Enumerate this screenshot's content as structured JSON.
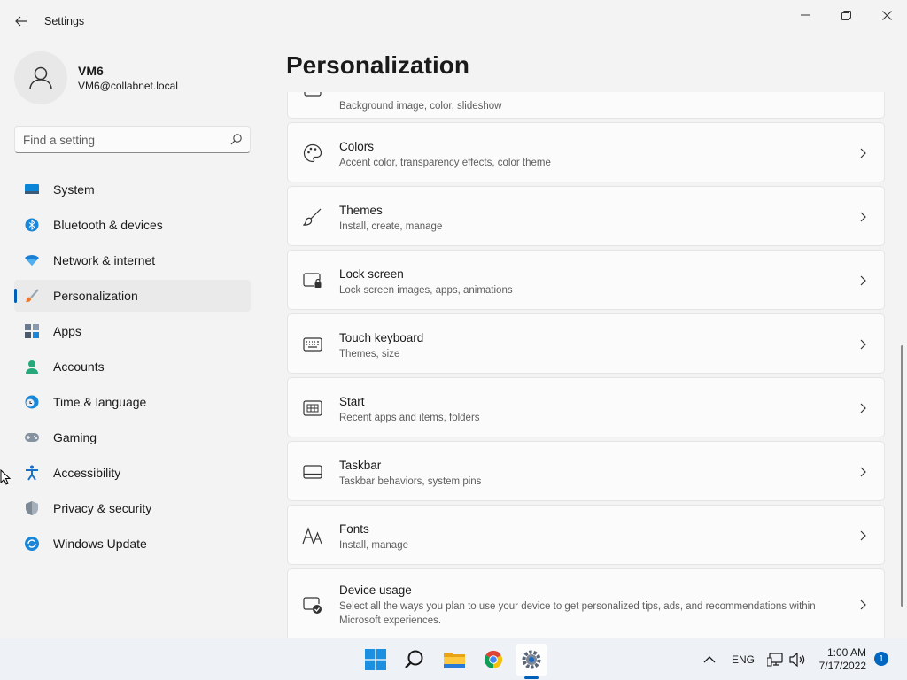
{
  "window": {
    "title": "Settings",
    "controls": [
      "minimize",
      "maximize",
      "close"
    ]
  },
  "profile": {
    "name": "VM6",
    "email": "VM6@collabnet.local"
  },
  "search": {
    "placeholder": "Find a setting"
  },
  "sidebar": {
    "items": [
      {
        "label": "System",
        "icon": "system-icon",
        "selected": false
      },
      {
        "label": "Bluetooth & devices",
        "icon": "bluetooth-icon",
        "selected": false
      },
      {
        "label": "Network & internet",
        "icon": "wifi-icon",
        "selected": false
      },
      {
        "label": "Personalization",
        "icon": "brush-icon",
        "selected": true
      },
      {
        "label": "Apps",
        "icon": "apps-icon",
        "selected": false
      },
      {
        "label": "Accounts",
        "icon": "accounts-icon",
        "selected": false
      },
      {
        "label": "Time & language",
        "icon": "time-language-icon",
        "selected": false
      },
      {
        "label": "Gaming",
        "icon": "gaming-icon",
        "selected": false
      },
      {
        "label": "Accessibility",
        "icon": "accessibility-icon",
        "selected": false
      },
      {
        "label": "Privacy & security",
        "icon": "shield-icon",
        "selected": false
      },
      {
        "label": "Windows Update",
        "icon": "update-icon",
        "selected": false
      }
    ]
  },
  "main": {
    "title": "Personalization",
    "cards": [
      {
        "title": "",
        "subtitle": "Background image, color, slideshow",
        "icon": "background-icon"
      },
      {
        "title": "Colors",
        "subtitle": "Accent color, transparency effects, color theme",
        "icon": "palette-icon"
      },
      {
        "title": "Themes",
        "subtitle": "Install, create, manage",
        "icon": "brush-icon"
      },
      {
        "title": "Lock screen",
        "subtitle": "Lock screen images, apps, animations",
        "icon": "lock-screen-icon"
      },
      {
        "title": "Touch keyboard",
        "subtitle": "Themes, size",
        "icon": "keyboard-icon"
      },
      {
        "title": "Start",
        "subtitle": "Recent apps and items, folders",
        "icon": "start-icon"
      },
      {
        "title": "Taskbar",
        "subtitle": "Taskbar behaviors, system pins",
        "icon": "taskbar-icon"
      },
      {
        "title": "Fonts",
        "subtitle": "Install, manage",
        "icon": "fonts-icon"
      },
      {
        "title": "Device usage",
        "subtitle": "Select all the ways you plan to use your device to get personalized tips, ads, and recommendations within Microsoft experiences.",
        "icon": "device-usage-icon"
      }
    ]
  },
  "taskbar": {
    "apps": [
      "start-icon",
      "search-icon",
      "file-explorer-icon",
      "chrome-icon",
      "settings-icon"
    ],
    "active_app": "settings-icon",
    "language": "ENG",
    "time": "1:00 AM",
    "date": "7/17/2022",
    "notification_count": "1"
  },
  "colors": {
    "accent": "#005fb8",
    "background": "#f3f3f3",
    "card": "#fbfbfb"
  }
}
